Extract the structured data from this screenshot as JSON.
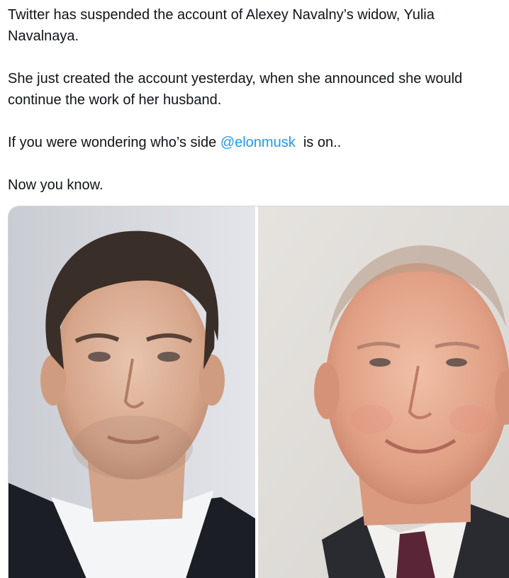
{
  "tweet": {
    "line1": "Twitter has suspended the account of Alexey Navalny’s widow, Yulia",
    "line2": "Navalnaya.",
    "line3": "She just created the account yesterday, when she announced she would",
    "line4": "continue the work of her husband.",
    "line5_prefix": "If you were wondering who’s side ",
    "mention": "@elonmusk",
    "line5_suffix": "  is on..",
    "line6": "Now you know."
  },
  "media": {
    "photos": [
      {
        "subject": "man-with-dark-hair-portrait"
      },
      {
        "subject": "balding-man-smiling-portrait"
      }
    ]
  },
  "colors": {
    "text": "#0f1419",
    "link": "#1d9bf0",
    "border": "#cfd9de"
  }
}
